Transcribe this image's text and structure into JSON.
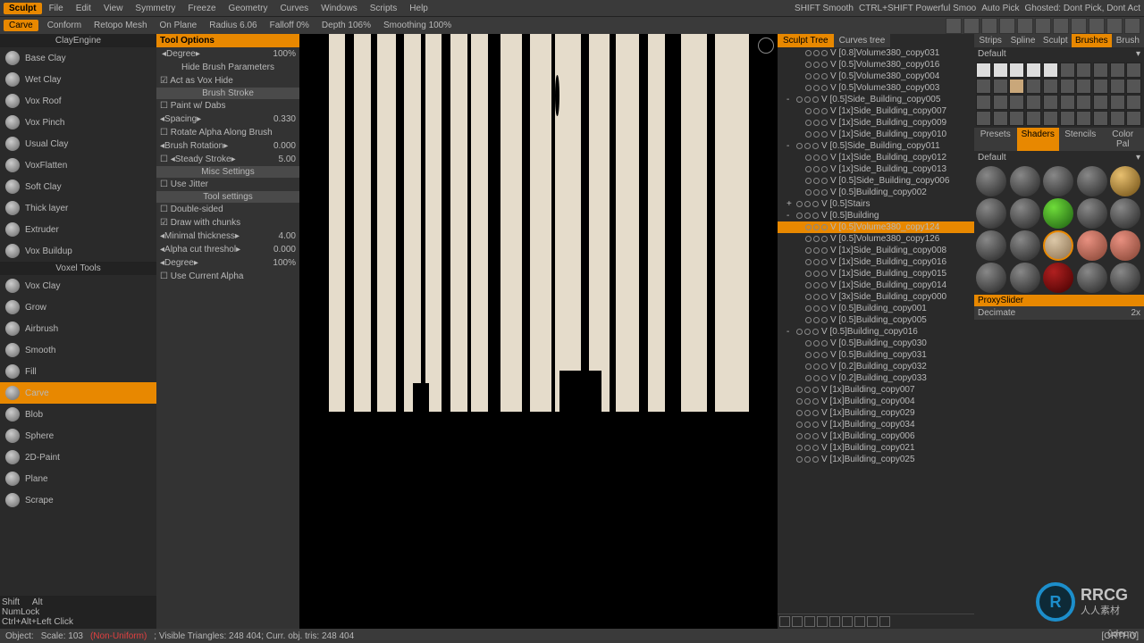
{
  "menubar": {
    "logo": "Sculpt",
    "items": [
      "File",
      "Edit",
      "View",
      "Symmetry",
      "Freeze",
      "Geometry",
      "Curves",
      "Windows",
      "Scripts",
      "Help"
    ],
    "hints": [
      "SHIFT Smooth",
      "CTRL+SHIFT Powerful Smoo",
      "Auto Pick",
      "Ghosted: Dont Pick, Dont Act"
    ]
  },
  "toolbar": {
    "tool": "Carve",
    "conform": "Conform",
    "retopo": "Retopo Mesh",
    "plane": "On Plane",
    "radius_label": "Radius",
    "radius_val": "6.06",
    "falloff_label": "Falloff",
    "falloff_val": "0%",
    "depth_label": "Depth",
    "depth_val": "106%",
    "smooth_label": "Smoothing",
    "smooth_val": "100%"
  },
  "brush_groups": {
    "clay_engine": "ClayEngine",
    "voxel_tools": "Voxel Tools",
    "brushes": [
      "Base Clay",
      "Wet Clay",
      "Vox Roof",
      "Vox Pinch",
      "Usual Clay",
      "VoxFlatten",
      "Soft Clay",
      "Thick layer",
      "Extruder",
      "Vox Buildup"
    ],
    "voxel_brushes": [
      "Vox Clay",
      "Grow",
      "Airbrush",
      "Smooth",
      "Fill",
      "Carve",
      "Blob",
      "Sphere",
      "2D-Paint",
      "Plane",
      "Scrape"
    ],
    "active": "Carve",
    "shortcuts": [
      "Shift",
      "Alt",
      "NumLock",
      "Ctrl+Alt+Left Click"
    ]
  },
  "options": {
    "header": "Tool Options",
    "degree": "Degree",
    "degree_val": "100%",
    "hide": "Hide Brush Parameters",
    "act_vox": "Act as Vox Hide",
    "sec_stroke": "Brush Stroke",
    "dabs": "Paint w/ Dabs",
    "spacing": "Spacing",
    "spacing_val": "0.330",
    "rotate_alpha": "Rotate Alpha Along Brush",
    "brush_rot": "Brush Rotation",
    "brush_rot_val": "0.000",
    "steady": "Steady Stroke",
    "steady_val": "5.00",
    "sec_misc": "Misc Settings",
    "jitter": "Use Jitter",
    "sec_tool": "Tool settings",
    "dsided": "Double-sided",
    "chunks": "Draw with chunks",
    "minthick": "Minimal thickness",
    "minthick_val": "4.00",
    "alphacut": "Alpha cut threshol",
    "alphacut_val": "0.000",
    "degree2": "Degree",
    "degree2_val": "100%",
    "use_alpha": "Use Current Alpha"
  },
  "tree": {
    "tabs": [
      "Sculpt Tree",
      "Curves tree"
    ],
    "items": [
      {
        "l": "V [0.8]Volume380_copy031",
        "i": 2
      },
      {
        "l": "V [0.5]Volume380_copy016",
        "i": 2
      },
      {
        "l": "V [0.5]Volume380_copy004",
        "i": 2
      },
      {
        "l": "V [0.5]Volume380_copy003",
        "i": 2
      },
      {
        "l": "V [0.5]Side_Building_copy005",
        "i": 1,
        "t": "-"
      },
      {
        "l": "V [1x]Side_Building_copy007",
        "i": 2
      },
      {
        "l": "V [1x]Side_Building_copy009",
        "i": 2
      },
      {
        "l": "V [1x]Side_Building_copy010",
        "i": 2
      },
      {
        "l": "V [0.5]Side_Building_copy011",
        "i": 1,
        "t": "-"
      },
      {
        "l": "V [1x]Side_Building_copy012",
        "i": 2
      },
      {
        "l": "V [1x]Side_Building_copy013",
        "i": 2
      },
      {
        "l": "V [0.5]Side_Building_copy006",
        "i": 2
      },
      {
        "l": "V [0.5]Building_copy002",
        "i": 2
      },
      {
        "l": "V [0.5]Stairs",
        "i": 1,
        "t": "+"
      },
      {
        "l": "V [0.5]Building",
        "i": 1,
        "t": "-"
      },
      {
        "l": "V [0.5]Volume380_copy124",
        "i": 2,
        "s": true
      },
      {
        "l": "V [0.5]Volume380_copy126",
        "i": 2
      },
      {
        "l": "V [1x]Side_Building_copy008",
        "i": 2
      },
      {
        "l": "V [1x]Side_Building_copy016",
        "i": 2
      },
      {
        "l": "V [1x]Side_Building_copy015",
        "i": 2
      },
      {
        "l": "V [1x]Side_Building_copy014",
        "i": 2
      },
      {
        "l": "V [3x]Side_Building_copy000",
        "i": 2
      },
      {
        "l": "V [0.5]Building_copy001",
        "i": 2
      },
      {
        "l": "V [0.5]Building_copy005",
        "i": 2
      },
      {
        "l": "V [0.5]Building_copy016",
        "i": 1,
        "t": "-"
      },
      {
        "l": "V [0.5]Building_copy030",
        "i": 2
      },
      {
        "l": "V [0.5]Building_copy031",
        "i": 2
      },
      {
        "l": "V [0.2]Building_copy032",
        "i": 2
      },
      {
        "l": "V [0.2]Building_copy033",
        "i": 2
      },
      {
        "l": "V [1x]Building_copy007",
        "i": 1
      },
      {
        "l": "V [1x]Building_copy004",
        "i": 1
      },
      {
        "l": "V [1x]Building_copy029",
        "i": 1
      },
      {
        "l": "V [1x]Building_copy034",
        "i": 1
      },
      {
        "l": "V [1x]Building_copy006",
        "i": 1
      },
      {
        "l": "V [1x]Building_copy021",
        "i": 1
      },
      {
        "l": "V [1x]Building_copy025",
        "i": 1
      }
    ]
  },
  "right": {
    "tabs_top": [
      "Strips",
      "Spline",
      "Sculpt",
      "Brushes",
      "Brush"
    ],
    "default": "Default",
    "tabs_mid": [
      "Presets",
      "Shaders",
      "Stencils",
      "Color Pal"
    ],
    "proxy": "ProxySlider",
    "decimate": "Decimate",
    "decimate_val": "2x"
  },
  "status": {
    "object": "Object:",
    "scale": "Scale: 103",
    "nonuni": "(Non-Uniform)",
    "tris": "; Visible Triangles: 248 404; Curr. obj. tris: 248 404",
    "ortho": "[ORTHO]"
  },
  "watermark": {
    "brand": "RRCG",
    "sub": "人人素材"
  },
  "udemy": "ûdemy"
}
